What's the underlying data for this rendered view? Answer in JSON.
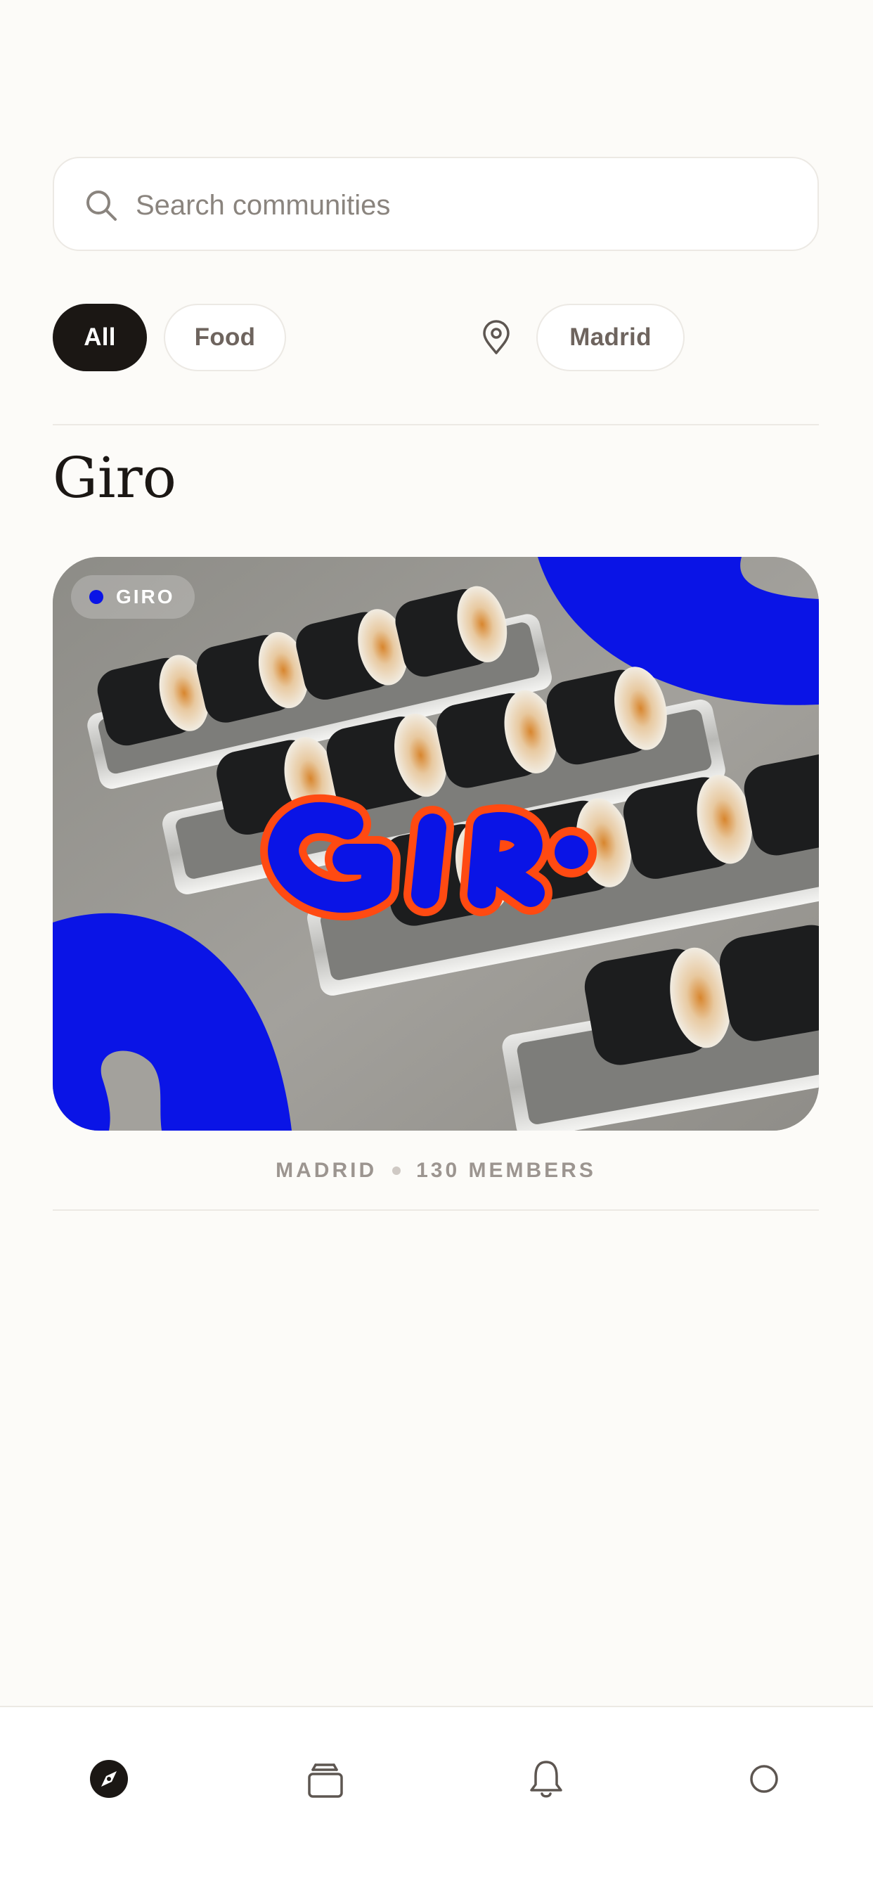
{
  "search": {
    "placeholder": "Search communities",
    "value": ""
  },
  "filters": {
    "chips": [
      {
        "label": "All",
        "selected": true
      },
      {
        "label": "Food",
        "selected": false
      }
    ],
    "location": {
      "icon": "location-pin-icon",
      "label": "Madrid"
    }
  },
  "section": {
    "title": "Giro"
  },
  "community_card": {
    "badge": "GIRO",
    "badge_dot_color": "#0a14e6",
    "brand_color": "#0a14e6",
    "accent_color": "#ff4a12",
    "city": "MADRID",
    "members": "130 MEMBERS"
  },
  "bottom_nav": {
    "items": [
      {
        "icon": "compass-icon",
        "active": true
      },
      {
        "icon": "ticket-stack-icon",
        "active": false
      },
      {
        "icon": "bell-icon",
        "active": false
      },
      {
        "icon": "profile-circle-icon",
        "active": false
      }
    ]
  }
}
